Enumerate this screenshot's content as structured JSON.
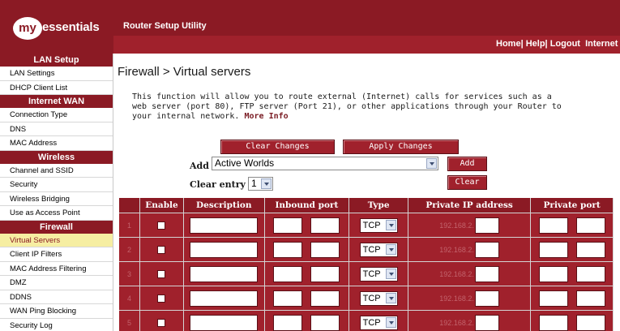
{
  "header": {
    "logo_circle": "my",
    "logo_text": "essentials",
    "title": "Router Setup Utility",
    "links": [
      "Home",
      "Help",
      "Logout",
      "Internet S"
    ]
  },
  "sidebar": {
    "sections": [
      {
        "title": "LAN Setup",
        "items": [
          {
            "label": "LAN Settings",
            "active": false
          },
          {
            "label": "DHCP Client List",
            "active": false
          }
        ]
      },
      {
        "title": "Internet WAN",
        "items": [
          {
            "label": "Connection Type",
            "active": false
          },
          {
            "label": "DNS",
            "active": false
          },
          {
            "label": "MAC Address",
            "active": false
          }
        ]
      },
      {
        "title": "Wireless",
        "items": [
          {
            "label": "Channel and SSID",
            "active": false
          },
          {
            "label": "Security",
            "active": false
          },
          {
            "label": "Wireless Bridging",
            "active": false
          },
          {
            "label": "Use as Access Point",
            "active": false
          }
        ]
      },
      {
        "title": "Firewall",
        "items": [
          {
            "label": "Virtual Servers",
            "active": true
          },
          {
            "label": "Client IP Filters",
            "active": false
          },
          {
            "label": "MAC Address Filtering",
            "active": false
          },
          {
            "label": "DMZ",
            "active": false
          },
          {
            "label": "DDNS",
            "active": false
          },
          {
            "label": "WAN Ping Blocking",
            "active": false
          },
          {
            "label": "Security Log",
            "active": false
          }
        ]
      }
    ]
  },
  "main": {
    "page_title": "Firewall > Virtual servers",
    "description": "This function will allow you to route external (Internet) calls for services such as a web server (port 80), FTP server (Port 21), or other applications through your Router to your internal network.",
    "more_info": "More Info",
    "buttons": {
      "clear_changes": "Clear Changes",
      "apply_changes": "Apply Changes",
      "add": "Add",
      "clear": "Clear"
    },
    "add_label": "Add",
    "add_select_value": "Active Worlds",
    "clear_entry_label": "Clear entry",
    "clear_entry_value": "1"
  },
  "table": {
    "headers": [
      "",
      "Enable",
      "Description",
      "Inbound port",
      "Type",
      "Private IP address",
      "Private port"
    ],
    "rows": [
      {
        "num": "1",
        "type": "TCP",
        "ip_prefix": "192.168.2."
      },
      {
        "num": "2",
        "type": "TCP",
        "ip_prefix": "192.168.2."
      },
      {
        "num": "3",
        "type": "TCP",
        "ip_prefix": "192.168.2."
      },
      {
        "num": "4",
        "type": "TCP",
        "ip_prefix": "192.168.2."
      },
      {
        "num": "5",
        "type": "TCP",
        "ip_prefix": "192.168.2."
      }
    ]
  },
  "colors": {
    "brand_red": "#8b1a24",
    "table_red": "#a0212c",
    "active_item_bg": "#f6eea2"
  }
}
